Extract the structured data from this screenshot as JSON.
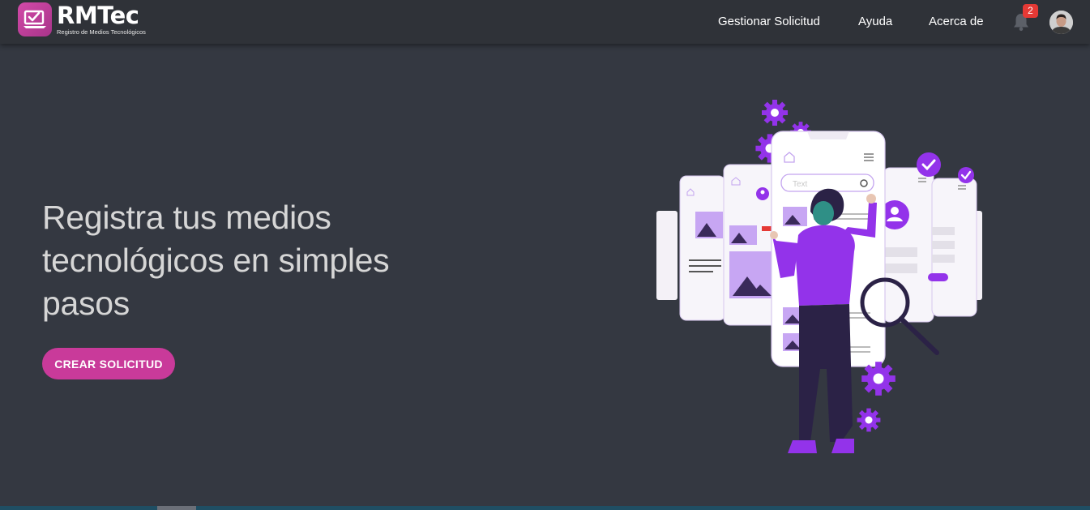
{
  "header": {
    "brand": {
      "title": "RMTec",
      "subtitle": "Registro de Medios Tecnológicos"
    },
    "nav": [
      {
        "label": "Gestionar Solicitud"
      },
      {
        "label": "Ayuda"
      },
      {
        "label": "Acerca de"
      }
    ],
    "notifications": {
      "icon": "bell-icon",
      "count": "2"
    },
    "user": {
      "icon": "user-avatar"
    }
  },
  "hero": {
    "title": "Registra tus medios tecnológicos en simples pasos",
    "cta_label": "CREAR SOLICITUD",
    "illustration": {
      "search_placeholder": "Text"
    }
  },
  "colors": {
    "background": "#343841",
    "topbar": "#2f3238",
    "accent": "#c93a9a",
    "illustration_purple": "#9333ea",
    "badge": "#e53935"
  }
}
